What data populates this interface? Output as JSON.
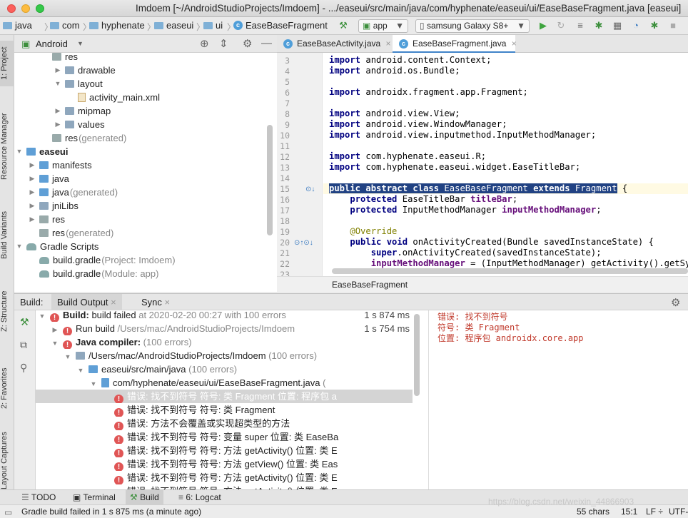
{
  "window": {
    "title": "Imdoem [~/AndroidStudioProjects/Imdoem] - .../easeui/src/main/java/com/hyphenate/easeui/ui/EaseBaseFragment.java [easeui]"
  },
  "nav": {
    "crumbs": [
      "java",
      "com",
      "hyphenate",
      "easeui",
      "ui",
      "EaseBaseFragment"
    ],
    "run_config": "app",
    "device": "samsung Galaxy S8+"
  },
  "left_tabs": [
    "1: Project",
    "Resource Manager",
    "Build Variants",
    "Z: Structure",
    "2: Favorites",
    "Layout Captures"
  ],
  "project": {
    "view_mode": "Android",
    "tree": [
      {
        "label": "res",
        "suffix": "",
        "indent": 3,
        "arrow": "",
        "icon": "res"
      },
      {
        "label": "drawable",
        "suffix": "",
        "indent": 4,
        "arrow": "▶",
        "icon": "folder"
      },
      {
        "label": "layout",
        "suffix": "",
        "indent": 4,
        "arrow": "▼",
        "icon": "folder"
      },
      {
        "label": "activity_main.xml",
        "suffix": "",
        "indent": 5,
        "arrow": "",
        "icon": "xml"
      },
      {
        "label": "mipmap",
        "suffix": "",
        "indent": 4,
        "arrow": "▶",
        "icon": "folder"
      },
      {
        "label": "values",
        "suffix": "",
        "indent": 4,
        "arrow": "▶",
        "icon": "folder"
      },
      {
        "label": "res",
        "suffix": " (generated)",
        "indent": 3,
        "arrow": "",
        "icon": "res"
      },
      {
        "label": "easeui",
        "suffix": "",
        "indent": 1,
        "arrow": "▼",
        "icon": "module",
        "bold": true
      },
      {
        "label": "manifests",
        "suffix": "",
        "indent": 2,
        "arrow": "▶",
        "icon": "folder-blue"
      },
      {
        "label": "java",
        "suffix": "",
        "indent": 2,
        "arrow": "▶",
        "icon": "folder-blue"
      },
      {
        "label": "java",
        "suffix": " (generated)",
        "indent": 2,
        "arrow": "▶",
        "icon": "folder-blue"
      },
      {
        "label": "jniLibs",
        "suffix": "",
        "indent": 2,
        "arrow": "▶",
        "icon": "folder"
      },
      {
        "label": "res",
        "suffix": "",
        "indent": 2,
        "arrow": "▶",
        "icon": "res"
      },
      {
        "label": "res",
        "suffix": " (generated)",
        "indent": 2,
        "arrow": "",
        "icon": "res"
      },
      {
        "label": "Gradle Scripts",
        "suffix": "",
        "indent": 1,
        "arrow": "▼",
        "icon": "gradle"
      },
      {
        "label": "build.gradle",
        "suffix": " (Project: Imdoem)",
        "indent": 2,
        "arrow": "",
        "icon": "gradle"
      },
      {
        "label": "build.gradle",
        "suffix": " (Module: app)",
        "indent": 2,
        "arrow": "",
        "icon": "gradle"
      }
    ]
  },
  "editor": {
    "tabs": [
      "EaseBaseActivity.java",
      "EaseBaseFragment.java"
    ],
    "active_tab": 1,
    "breadcrumb": "EaseBaseFragment",
    "lines": [
      {
        "n": "3",
        "html": "<span class=\"kw\">import</span> android.content.Context;"
      },
      {
        "n": "4",
        "html": "<span class=\"kw\">import</span> android.os.Bundle;"
      },
      {
        "n": "5",
        "html": ""
      },
      {
        "n": "6",
        "html": "<span class=\"kw\">import</span> androidx.fragment.app.Fragment;"
      },
      {
        "n": "7",
        "html": ""
      },
      {
        "n": "8",
        "html": "<span class=\"kw\">import</span> android.view.View;"
      },
      {
        "n": "9",
        "html": "<span class=\"kw\">import</span> android.view.WindowManager;"
      },
      {
        "n": "10",
        "html": "<span class=\"kw\">import</span> android.view.inputmethod.InputMethodManager;"
      },
      {
        "n": "11",
        "html": ""
      },
      {
        "n": "12",
        "html": "<span class=\"kw\">import</span> com.hyphenate.easeui.R;"
      },
      {
        "n": "13",
        "html": "<span class=\"kw\">import</span> com.hyphenate.easeui.widget.EaseTitleBar;"
      },
      {
        "n": "14",
        "html": ""
      },
      {
        "n": "15",
        "html": "<span class=\"hl\"><span class=\"kw\">public abstract class</span> EaseBaseFragment <span class=\"kw\">extends</span> Fragment</span> {"
      },
      {
        "n": "16",
        "html": "    <span class=\"kw\">protected</span> EaseTitleBar <span class=\"fld\">titleBar</span>;"
      },
      {
        "n": "17",
        "html": "    <span class=\"kw\">protected</span> InputMethodManager <span class=\"fld\">inputMethodManager</span>;"
      },
      {
        "n": "18",
        "html": ""
      },
      {
        "n": "19",
        "html": "    <span class=\"ann\">@Override</span>"
      },
      {
        "n": "20",
        "html": "    <span class=\"kw\">public void</span> onActivityCreated(Bundle savedInstanceState) {"
      },
      {
        "n": "21",
        "html": "        <span class=\"kw\">super</span>.onActivityCreated(savedInstanceState);"
      },
      {
        "n": "22",
        "html": "        <span class=\"fld\">inputMethodManager</span> = (InputMethodManager) getActivity().getSyste"
      },
      {
        "n": "23",
        "html": ""
      }
    ]
  },
  "build": {
    "tab_label": "Build:",
    "tabs": [
      "Build Output",
      "Sync"
    ],
    "rows": [
      {
        "indent": 0,
        "arrow": "▼",
        "icon": "err",
        "html": "<b>Build:</b> build failed <span class=\"grey\">at 2020-02-20 00:27  with 100 errors</span>",
        "time": "1 s 874 ms"
      },
      {
        "indent": 1,
        "arrow": "▶",
        "icon": "err",
        "html": "Run build <span class=\"grey\">/Users/mac/AndroidStudioProjects/Imdoem</span>",
        "time": "1 s 754 ms"
      },
      {
        "indent": 1,
        "arrow": "▼",
        "icon": "err",
        "html": "<b>Java compiler:</b> <span class=\"grey\">(100 errors)</span>",
        "time": ""
      },
      {
        "indent": 2,
        "arrow": "▼",
        "icon": "folder",
        "html": "/Users/mac/AndroidStudioProjects/Imdoem <span class=\"grey\">(100 errors)</span>",
        "time": ""
      },
      {
        "indent": 3,
        "arrow": "▼",
        "icon": "folder-blue",
        "html": "easeui/src/main/java <span class=\"grey\">(100 errors)</span>",
        "time": ""
      },
      {
        "indent": 4,
        "arrow": "▼",
        "icon": "java",
        "html": "com/hyphenate/easeui/ui/EaseBaseFragment.java <span class=\"grey\">(</span>",
        "time": ""
      },
      {
        "indent": 5,
        "arrow": "",
        "icon": "err",
        "html": "错误: 找不到符号 符号:  类 Fragment 位置: 程序包 a",
        "time": "",
        "sel": true
      },
      {
        "indent": 5,
        "arrow": "",
        "icon": "err",
        "html": "错误: 找不到符号 符号: 类 Fragment",
        "time": ""
      },
      {
        "indent": 5,
        "arrow": "",
        "icon": "err",
        "html": "错误: 方法不会覆盖或实现超类型的方法",
        "time": ""
      },
      {
        "indent": 5,
        "arrow": "",
        "icon": "err",
        "html": "错误: 找不到符号 符号:   变量 super 位置: 类 EaseBa",
        "time": ""
      },
      {
        "indent": 5,
        "arrow": "",
        "icon": "err",
        "html": "错误: 找不到符号 符号:   方法 getActivity() 位置: 类 E",
        "time": ""
      },
      {
        "indent": 5,
        "arrow": "",
        "icon": "err",
        "html": "错误: 找不到符号 符号:   方法 getView() 位置: 类 Eas",
        "time": ""
      },
      {
        "indent": 5,
        "arrow": "",
        "icon": "err",
        "html": "错误: 找不到符号 符号:   方法 getActivity() 位置: 类 E",
        "time": ""
      },
      {
        "indent": 5,
        "arrow": "",
        "icon": "err",
        "html": "错误: 找不到符号 符号:   方法 getActivity() 位置: 类 E",
        "time": ""
      }
    ],
    "detail_lines": [
      "错误: 找不到符号",
      "符号:   类 Fragment",
      "位置: 程序包 androidx.core.app"
    ]
  },
  "bottom_tabs": [
    "TODO",
    "Terminal",
    "Build",
    "6: Logcat"
  ],
  "status": {
    "message": "Gradle build failed in 1 s 875 ms (a minute ago)",
    "chars": "55 chars",
    "position": "15:1",
    "line_sep": "LF ÷",
    "encoding": "UTF-",
    "watermark": "https://blog.csdn.net/weixin_44866903"
  }
}
